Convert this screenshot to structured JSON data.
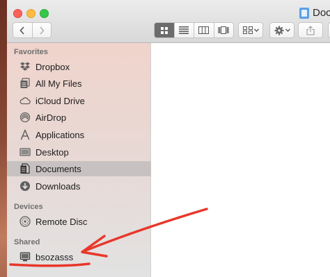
{
  "window": {
    "title": "Docu"
  },
  "sidebar": {
    "sections": {
      "favorites": "Favorites",
      "devices": "Devices",
      "shared": "Shared"
    },
    "favorites": [
      {
        "label": "Dropbox",
        "icon": "dropbox-icon"
      },
      {
        "label": "All My Files",
        "icon": "all-my-files-icon"
      },
      {
        "label": "iCloud Drive",
        "icon": "cloud-icon"
      },
      {
        "label": "AirDrop",
        "icon": "airdrop-icon"
      },
      {
        "label": "Applications",
        "icon": "applications-icon"
      },
      {
        "label": "Desktop",
        "icon": "desktop-icon"
      },
      {
        "label": "Documents",
        "icon": "documents-icon",
        "selected": true
      },
      {
        "label": "Downloads",
        "icon": "downloads-icon"
      }
    ],
    "devices": [
      {
        "label": "Remote Disc",
        "icon": "disc-icon"
      }
    ],
    "shared": [
      {
        "label": "bsozasss",
        "icon": "computer-icon"
      }
    ]
  },
  "colors": {
    "selection": "#c7c2c1",
    "annotation": "#e8372b"
  }
}
